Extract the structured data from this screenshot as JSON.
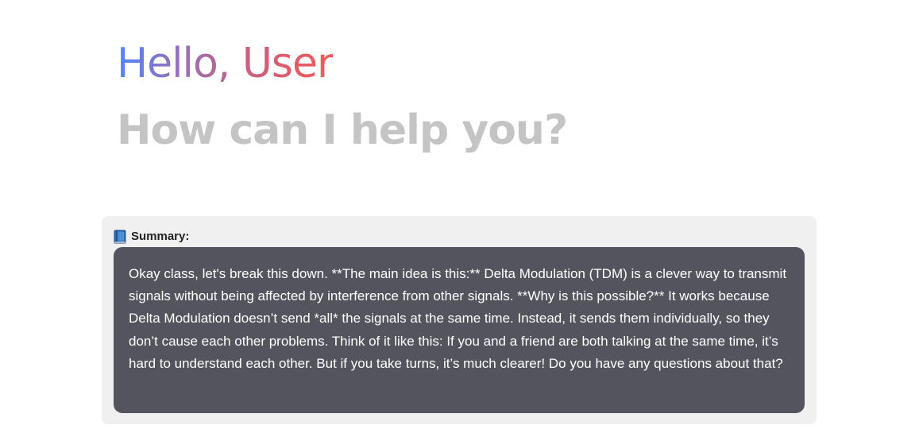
{
  "greeting": {
    "text": "Hello, User",
    "gradient_colors": [
      "#4f86f7",
      "#9a6fb7",
      "#c8607e",
      "#f25a5a"
    ]
  },
  "subheading": {
    "text": "How can I help you?",
    "color": "#c4c4c4"
  },
  "summary": {
    "icon": "book-icon",
    "label": "Summary:",
    "body": "Okay class, let's break this down. **The main idea is this:** Delta Modulation (TDM) is a clever way to transmit signals without being affected by interference from other signals. **Why is this possible?** It works because Delta Modulation doesn’t send *all* the signals at the same time. Instead, it sends them individually, so they don’t cause each other problems. Think of it like this: If you and a friend are both talking at the same time, it’s hard to understand each other. But if you take turns, it’s much clearer! Do you have any questions about that?",
    "card_color": "#f0f0f0",
    "body_color": "#54545e"
  }
}
